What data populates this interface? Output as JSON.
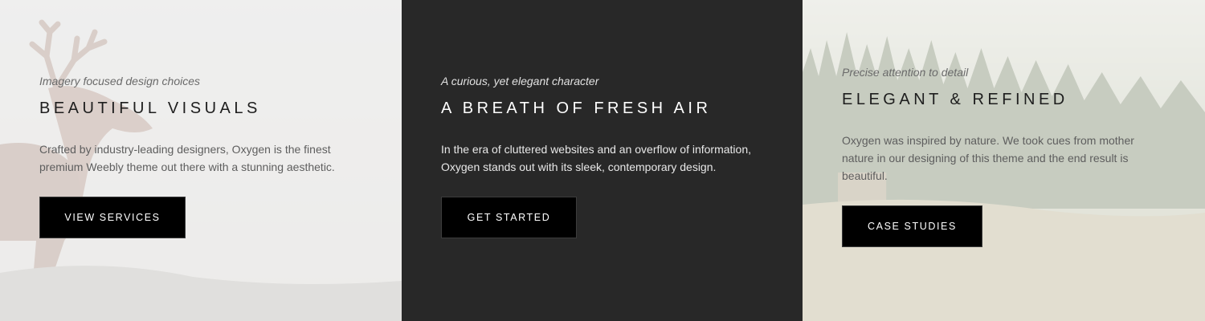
{
  "panels": [
    {
      "eyebrow": "Imagery focused design choices",
      "heading": "BEAUTIFUL VISUALS",
      "body_lines": [
        "Crafted by industry-leading designers, Oxygen is the finest",
        "premium Weebly theme out there with a stunning aesthetic."
      ],
      "button_label": "VIEW SERVICES",
      "background_image": "deer-photo"
    },
    {
      "eyebrow": "A curious, yet elegant character",
      "heading": "A BREATH OF FRESH AIR",
      "body_lines": [
        "In the era of cluttered websites and an overflow of information,",
        "Oxygen stands out with its sleek, contemporary design."
      ],
      "button_label": "GET STARTED",
      "background_color": "#282828"
    },
    {
      "eyebrow": "Precise attention to detail",
      "heading": "ELEGANT & REFINED",
      "body_lines": [
        "Oxygen was inspired by nature. We took cues from mother",
        "nature in our designing of this theme and the end result is",
        "beautiful."
      ],
      "button_label": "CASE STUDIES",
      "background_image": "forest-photo"
    }
  ],
  "colors": {
    "button_bg": "#000000",
    "button_text": "#ffffff",
    "dark_panel": "#282828",
    "light_panel": "#f2f2f2"
  }
}
